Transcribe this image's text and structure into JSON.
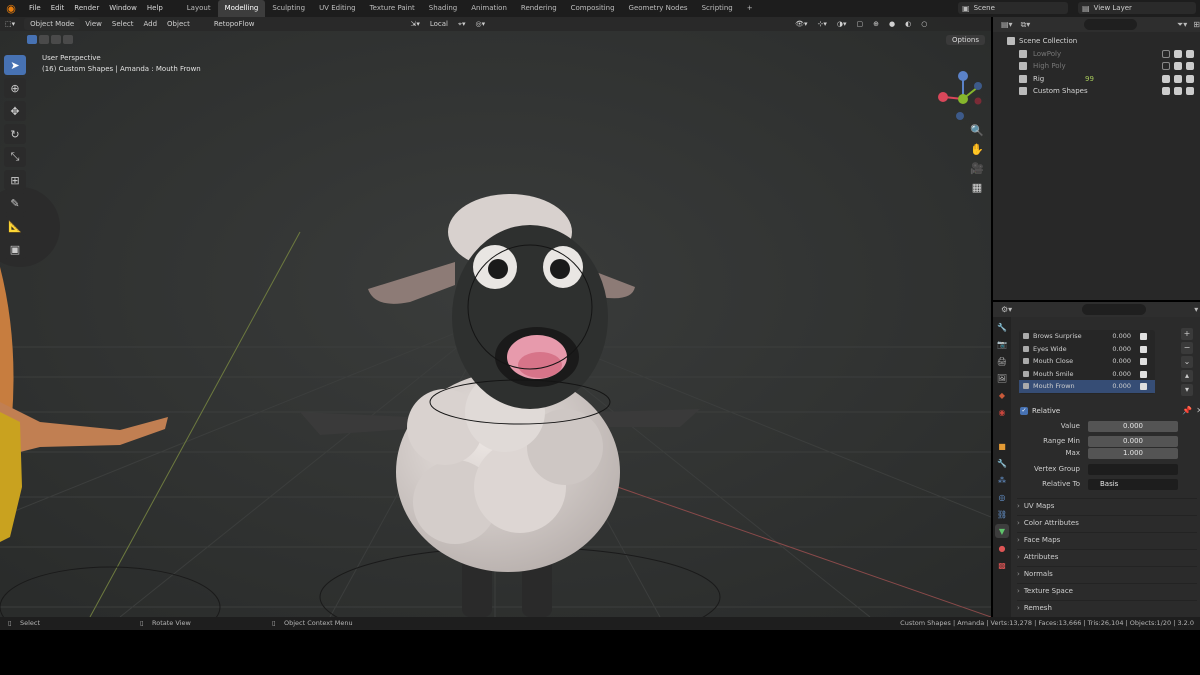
{
  "menu": [
    "File",
    "Edit",
    "Render",
    "Window",
    "Help"
  ],
  "workspaces": [
    "Layout",
    "Modelling",
    "Sculpting",
    "UV Editing",
    "Texture Paint",
    "Shading",
    "Animation",
    "Rendering",
    "Compositing",
    "Geometry Nodes",
    "Scripting",
    "+"
  ],
  "active_workspace": "Modelling",
  "scene": "Scene",
  "view_layer": "View Layer",
  "viewport": {
    "mode": "Object Mode",
    "header_menu": [
      "View",
      "Select",
      "Add",
      "Object",
      "RetopoFlow"
    ],
    "orientation": "Local",
    "options": "Options",
    "info_line1": "User Perspective",
    "info_line2": "(16) Custom Shapes | Amanda : Mouth Frown"
  },
  "outliner": {
    "rows": [
      {
        "label": "Scene Collection",
        "dim": false,
        "indent": 1
      },
      {
        "label": "LowPoly",
        "dim": true,
        "indent": 2
      },
      {
        "label": "High Poly",
        "dim": true,
        "indent": 2
      },
      {
        "label": "Rig",
        "dim": false,
        "indent": 2
      },
      {
        "label": "Custom Shapes",
        "dim": false,
        "indent": 2
      }
    ],
    "rig_badge": "99"
  },
  "shape_keys": [
    {
      "name": "Brows Surprise",
      "value": "0.000"
    },
    {
      "name": "Eyes Wide",
      "value": "0.000"
    },
    {
      "name": "Mouth Close",
      "value": "0.000"
    },
    {
      "name": "Mouth Smile",
      "value": "0.000"
    },
    {
      "name": "Mouth Frown",
      "value": "0.000"
    }
  ],
  "relative_label": "Relative",
  "fields": {
    "value_label": "Value",
    "value": "0.000",
    "range_min_label": "Range Min",
    "range_min": "0.000",
    "max_label": "Max",
    "max": "1.000",
    "vertex_group_label": "Vertex Group",
    "vertex_group": "",
    "relative_to_label": "Relative To",
    "relative_to": "Basis"
  },
  "panels": [
    "UV Maps",
    "Color Attributes",
    "Face Maps",
    "Attributes",
    "Normals",
    "Texture Space",
    "Remesh"
  ],
  "status": {
    "select": "Select",
    "rotate": "Rotate View",
    "context": "Object Context Menu",
    "stats": "Custom Shapes | Amanda | Verts:13,278 | Faces:13,666 | Tris:26,104 | Objects:1/20 | 3.2.0"
  },
  "colors": {
    "accent": "#4772b3",
    "brand": "#e87d0d",
    "viewport_bg": "#303231"
  }
}
